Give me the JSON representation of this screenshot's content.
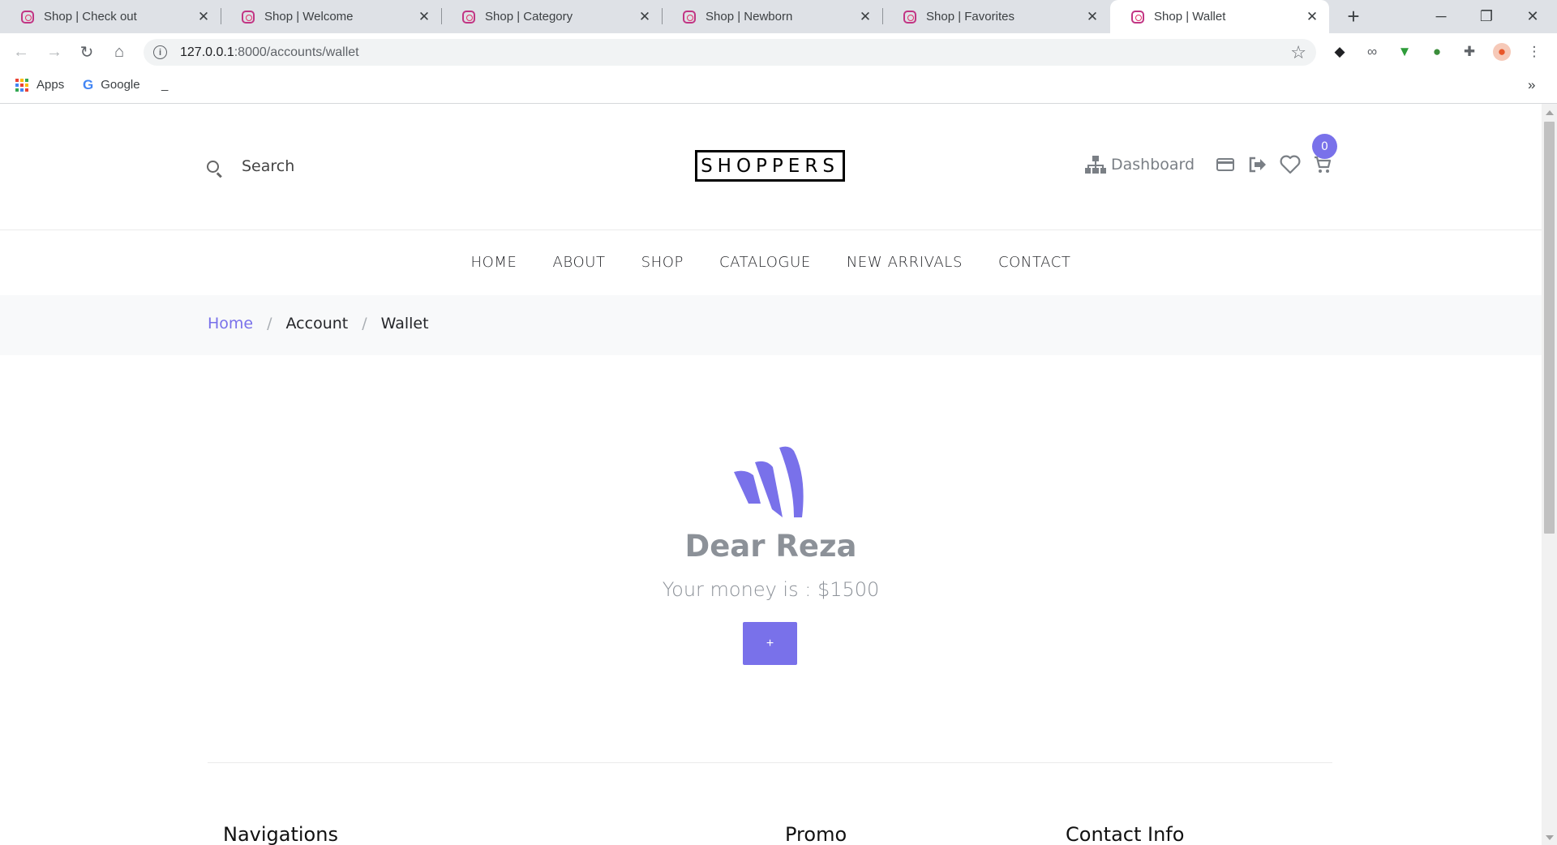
{
  "browser": {
    "tabs": [
      {
        "title": "Shop | Check out"
      },
      {
        "title": "Shop | Welcome"
      },
      {
        "title": "Shop | Category"
      },
      {
        "title": "Shop | Newborn"
      },
      {
        "title": "Shop | Favorites"
      },
      {
        "title": "Shop | Wallet",
        "active": true
      }
    ],
    "url_host": "127.0.0.1",
    "url_path": ":8000/accounts/wallet",
    "bookmarks": [
      {
        "label": "Apps",
        "icon": "apps-grid-icon"
      },
      {
        "label": "Google",
        "icon": "google-icon"
      },
      {
        "label": "_",
        "icon": ""
      }
    ],
    "overflow_label": "»"
  },
  "site": {
    "search_placeholder": "Search",
    "logo_text": "SHOPPERS",
    "dashboard_label": "Dashboard",
    "cart_count": "0",
    "accent_color": "#7971ea",
    "nav": [
      "HOME",
      "ABOUT",
      "SHOP",
      "CATALOGUE",
      "NEW ARRIVALS",
      "CONTACT"
    ],
    "breadcrumb": {
      "home": "Home",
      "account": "Account",
      "current": "Wallet",
      "separator": "/"
    },
    "wallet": {
      "greeting": "Dear Reza",
      "balance_text": "Your money is : $1500",
      "add_button_label": "+"
    },
    "footer": {
      "navigations": "Navigations",
      "promo": "Promo",
      "contact": "Contact Info"
    }
  }
}
